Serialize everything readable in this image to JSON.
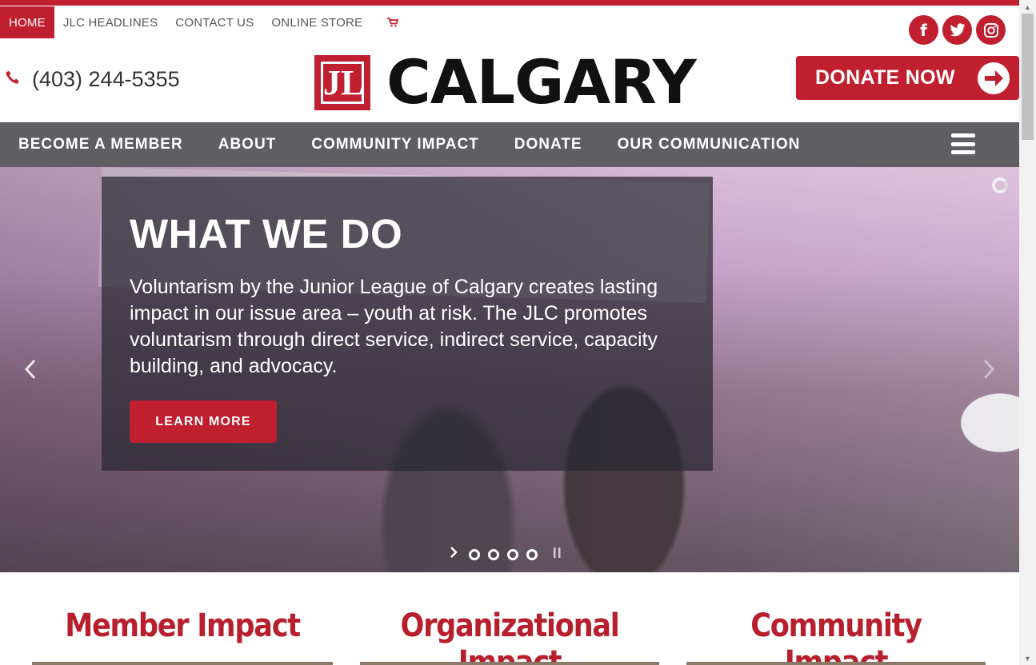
{
  "util_nav": {
    "items": [
      "HOME",
      "JLC HEADLINES",
      "CONTACT US",
      "ONLINE STORE"
    ],
    "cart_icon": "cart-icon"
  },
  "social": {
    "facebook": "f",
    "twitter": "t",
    "instagram": "◎"
  },
  "header": {
    "phone": "(403) 244-5355",
    "logo_mark": "JL",
    "logo_text": "CALGARY",
    "donate_label": "DONATE NOW"
  },
  "main_nav": {
    "items": [
      "BECOME A MEMBER",
      "ABOUT",
      "COMMUNITY IMPACT",
      "DONATE",
      "OUR COMMUNICATION"
    ]
  },
  "hero": {
    "title": "WHAT WE DO",
    "body": "Voluntarism by the Junior League of Calgary creates lasting impact in our issue area – youth at risk. The JLC promotes voluntarism through direct service, indirect service, capacity building, and advocacy.",
    "button": "LEARN MORE"
  },
  "impact": {
    "member": "Member Impact",
    "organizational": "Organizational Impact",
    "community": "Community Impact"
  },
  "colors": {
    "brand_red": "#c01f2f",
    "nav_gray": "#5e5e63"
  }
}
